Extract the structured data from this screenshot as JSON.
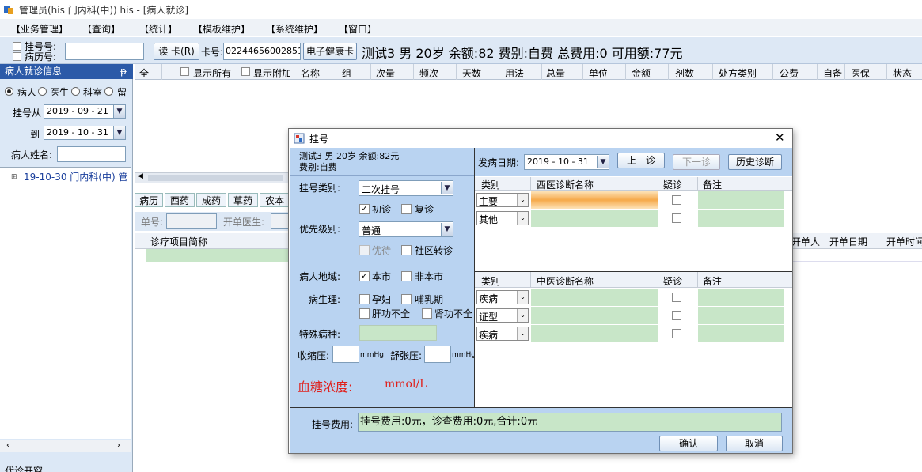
{
  "window": {
    "title": "管理员(his 门内科(中)) his - [病人就诊]"
  },
  "menu": [
    "【业务管理】",
    "【查询】",
    "【统计】",
    "【模板维护】",
    "【系统维护】",
    "【窗口】"
  ],
  "toolbar": {
    "reg_no_label": "挂号号:",
    "record_no_label": "病历号:",
    "read_card": "读 卡(R)",
    "card_label": "卡号:",
    "card_value": "022446560028510",
    "health_card": "电子健康卡",
    "patient_summary": "测试3 男 20岁 余额:82 费别:自费 总费用:0 可用额:77元"
  },
  "left_panel": {
    "header": "病人就诊信息",
    "pin": "ᵽ",
    "radios": [
      "病人",
      "医生",
      "科室",
      "留"
    ],
    "from_label": "挂号从",
    "from_date": "2019 - 09 - 21",
    "to_label": "到",
    "to_date": "2019 - 10 - 31",
    "name_label": "病人姓名:",
    "tree_item": "19-10-30 门内科(中) 管",
    "bottom_label": "代诊开窗"
  },
  "grid_header": {
    "all": "全",
    "show_all": "显示所有",
    "show_extra": "显示附加",
    "columns": [
      "名称",
      "组",
      "次量",
      "频次",
      "天数",
      "用法",
      "总量",
      "单位",
      "金额",
      "剂数",
      "处方类别",
      "公费",
      "自备",
      "医保",
      "状态"
    ]
  },
  "rx_tabs": [
    "病历",
    "西药",
    "成药",
    "草药",
    "农本"
  ],
  "order_bar": {
    "order_no": "单号:",
    "doctor": "开单医生:"
  },
  "lower_grid": {
    "item": "诊疗项目简称",
    "right_cols": [
      "开单人",
      "开单日期",
      "开单时间"
    ]
  },
  "dialog": {
    "title": "挂号",
    "close": "✕",
    "patient_line1": "测试3 男 20岁 余额:82元",
    "patient_line2": "费别:自费",
    "reg_type_label": "挂号类别:",
    "reg_type_value": "二次挂号",
    "first_visit": "初诊",
    "revisit": "复诊",
    "priority_label": "优先级别:",
    "priority_value": "普通",
    "preferential": "优待",
    "community": "社区转诊",
    "region_label": "病人地域:",
    "local": "本市",
    "nonlocal": "非本市",
    "physio_label": "病生理:",
    "pregnant": "孕妇",
    "lactation": "哺乳期",
    "liver": "肝功不全",
    "kidney": "肾功不全",
    "special_label": "特殊病种:",
    "systolic_label": "收缩压:",
    "diastolic_label": "舒张压:",
    "unit_mmhg": "mmHg",
    "glucose_label": "血糖浓度:",
    "glucose_unit": "mmol/L",
    "onset_label": "发病日期:",
    "onset_date": "2019 - 10 - 31",
    "prev_visit": "上一诊",
    "next_visit": "下一诊",
    "history": "历史诊断",
    "west_table": {
      "headers": [
        "类别",
        "西医诊断名称",
        "疑诊",
        "备注"
      ],
      "rows": [
        "主要",
        "其他"
      ]
    },
    "tcm_table": {
      "headers": [
        "类别",
        "中医诊断名称",
        "疑诊",
        "备注"
      ],
      "rows": [
        "疾病",
        "证型",
        "疾病"
      ]
    },
    "fee_label": "挂号费用:",
    "fee_text": "挂号费用:0元，诊查费用:0元,合计:0元",
    "ok": "确认",
    "cancel": "取消"
  },
  "colors": {
    "accent": "#2b5aa8",
    "panel": "#b9d3f1",
    "cell_green": "#c8e6c8",
    "glucose_red": "#e0201c"
  }
}
